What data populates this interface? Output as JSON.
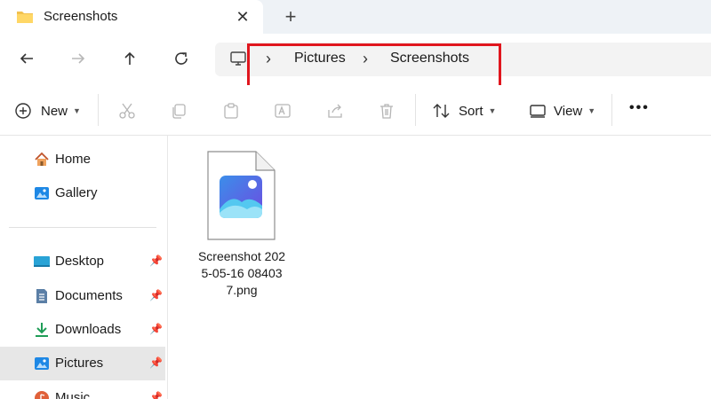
{
  "tab": {
    "title": "Screenshots",
    "close_glyph": "✕",
    "new_tab_glyph": "+"
  },
  "breadcrumb": [
    "Pictures",
    "Screenshots"
  ],
  "toolbar": {
    "new_label": "New",
    "sort_label": "Sort",
    "view_label": "View",
    "more_glyph": "•••"
  },
  "sidebar": {
    "items": [
      {
        "label": "Home",
        "icon": "home-icon"
      },
      {
        "label": "Gallery",
        "icon": "gallery-icon"
      },
      {
        "label": "Desktop",
        "icon": "desktop-icon",
        "pinned": true
      },
      {
        "label": "Documents",
        "icon": "documents-icon",
        "pinned": true
      },
      {
        "label": "Downloads",
        "icon": "downloads-icon",
        "pinned": true
      },
      {
        "label": "Pictures",
        "icon": "pictures-icon",
        "pinned": true,
        "selected": true
      },
      {
        "label": "Music",
        "icon": "music-icon",
        "pinned": true
      }
    ]
  },
  "files": [
    {
      "name": "Screenshot 2025-05-16 084037.png",
      "icon": "image-file-icon"
    }
  ],
  "colors": {
    "highlight_border": "#e0161e",
    "selected_bg": "#e7e7e7",
    "accent": "#0067c0"
  }
}
